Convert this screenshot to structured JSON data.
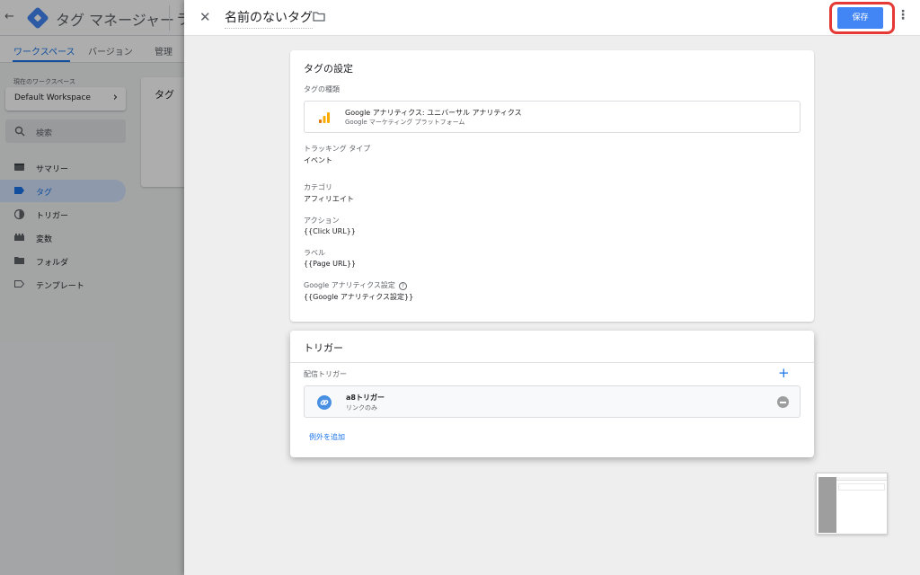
{
  "app": {
    "title": "タグ マネージャー",
    "title_tail": "ラ",
    "nav_tabs": [
      {
        "label": "ワークスペース",
        "active": true
      },
      {
        "label": "バージョン",
        "active": false
      },
      {
        "label": "管理",
        "active": false
      }
    ],
    "workspace_label": "現在のワークスペース",
    "workspace_name": "Default Workspace",
    "search_placeholder": "検索",
    "sidebar_items": [
      {
        "label": "サマリー",
        "icon": "summary-icon",
        "active": false
      },
      {
        "label": "タグ",
        "icon": "tag-icon",
        "active": true
      },
      {
        "label": "トリガー",
        "icon": "trigger-icon",
        "active": false
      },
      {
        "label": "変数",
        "icon": "variable-icon",
        "active": false
      },
      {
        "label": "フォルダ",
        "icon": "folder-icon",
        "active": false
      },
      {
        "label": "テンプレート",
        "icon": "template-icon",
        "active": false
      }
    ],
    "content_card_title": "タグ"
  },
  "panel": {
    "tag_name": "名前のないタグ",
    "save_label": "保存",
    "tag_config": {
      "title": "タグの設定",
      "type_label": "タグの種類",
      "type_name": "Google アナリティクス: ユニバーサル アナリティクス",
      "type_subtitle": "Google マーケティング プラットフォーム",
      "tracking_type_label": "トラッキング タイプ",
      "tracking_type_value": "イベント",
      "category_label": "カテゴリ",
      "category_value": "アフィリエイト",
      "action_label": "アクション",
      "action_value": "{{Click URL}}",
      "label_label": "ラベル",
      "label_value": "{{Page URL}}",
      "ga_settings_label": "Google アナリティクス設定",
      "ga_settings_value": "{{Google アナリティクス設定}}"
    },
    "triggering": {
      "title": "トリガー",
      "firing_label": "配信トリガー",
      "trigger_name": "a8トリガー",
      "trigger_type": "リンクのみ",
      "add_exception": "例外を追加"
    }
  },
  "colors": {
    "accent": "#1a73e8",
    "save_button": "#4285f4",
    "highlight": "#e53935",
    "ga_orange": "#f9ab00"
  }
}
